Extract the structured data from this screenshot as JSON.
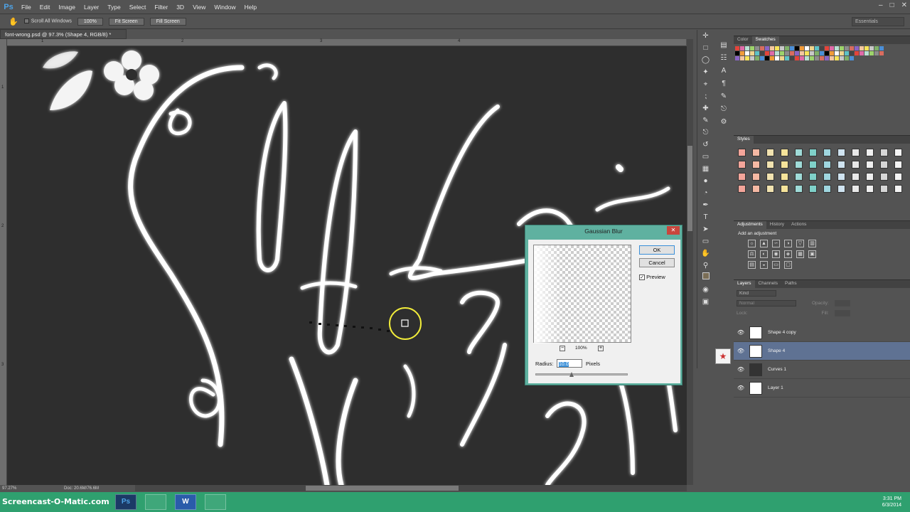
{
  "app": {
    "logo": "Ps"
  },
  "menubar": {
    "items": [
      "File",
      "Edit",
      "Image",
      "Layer",
      "Type",
      "Select",
      "Filter",
      "3D",
      "View",
      "Window",
      "Help"
    ]
  },
  "options_bar": {
    "scroll_all_windows": "Scroll All Windows",
    "btn_100": "100%",
    "btn_fit": "Fit Screen",
    "btn_fill": "Fill Screen",
    "workspace": "Essentials"
  },
  "document": {
    "tab_title": "font-wrong.psd @ 97.3% (Shape 4, RGB/8) *",
    "ruler_h": [
      "1",
      "2",
      "3",
      "4"
    ],
    "ruler_v": [
      "1",
      "2",
      "3"
    ]
  },
  "status": {
    "zoom": "97.27%",
    "doc": "Doc: 20.6M/76.6M"
  },
  "panels": {
    "color_tabs": [
      "Color",
      "Swatches"
    ],
    "styles_tab": "Styles",
    "adjust_tabs": [
      "Adjustments",
      "History",
      "Actions"
    ],
    "adjust_heading": "Add an adjustment",
    "layers_tabs": [
      "Layers",
      "Channels",
      "Paths"
    ],
    "layers_filter": "Kind",
    "blend_mode": "Normal",
    "opacity_label": "Opacity:",
    "lock_label": "Lock:",
    "fill_label": "Fill:",
    "layers": [
      {
        "name": "Shape 4 copy",
        "selected": false
      },
      {
        "name": "Shape 4",
        "selected": true
      },
      {
        "name": "Curves 1",
        "selected": false
      },
      {
        "name": "Layer 1",
        "selected": false
      }
    ]
  },
  "dialog": {
    "title": "Gaussian Blur",
    "ok": "OK",
    "cancel": "Cancel",
    "preview_label": "Preview",
    "preview_checked": true,
    "zoom_label": "100%",
    "radius_label": "Radius:",
    "radius_value": "10.0",
    "radius_unit": "Pixels"
  },
  "taskbar": {
    "watermark": "Screencast-O-Matic.com",
    "time": "3:31 PM",
    "date": "6/3/2014"
  },
  "colors": {
    "accent_dialog": "#5fb1a0",
    "taskbar": "#2fa06f",
    "layer_selected": "#5f7293"
  }
}
